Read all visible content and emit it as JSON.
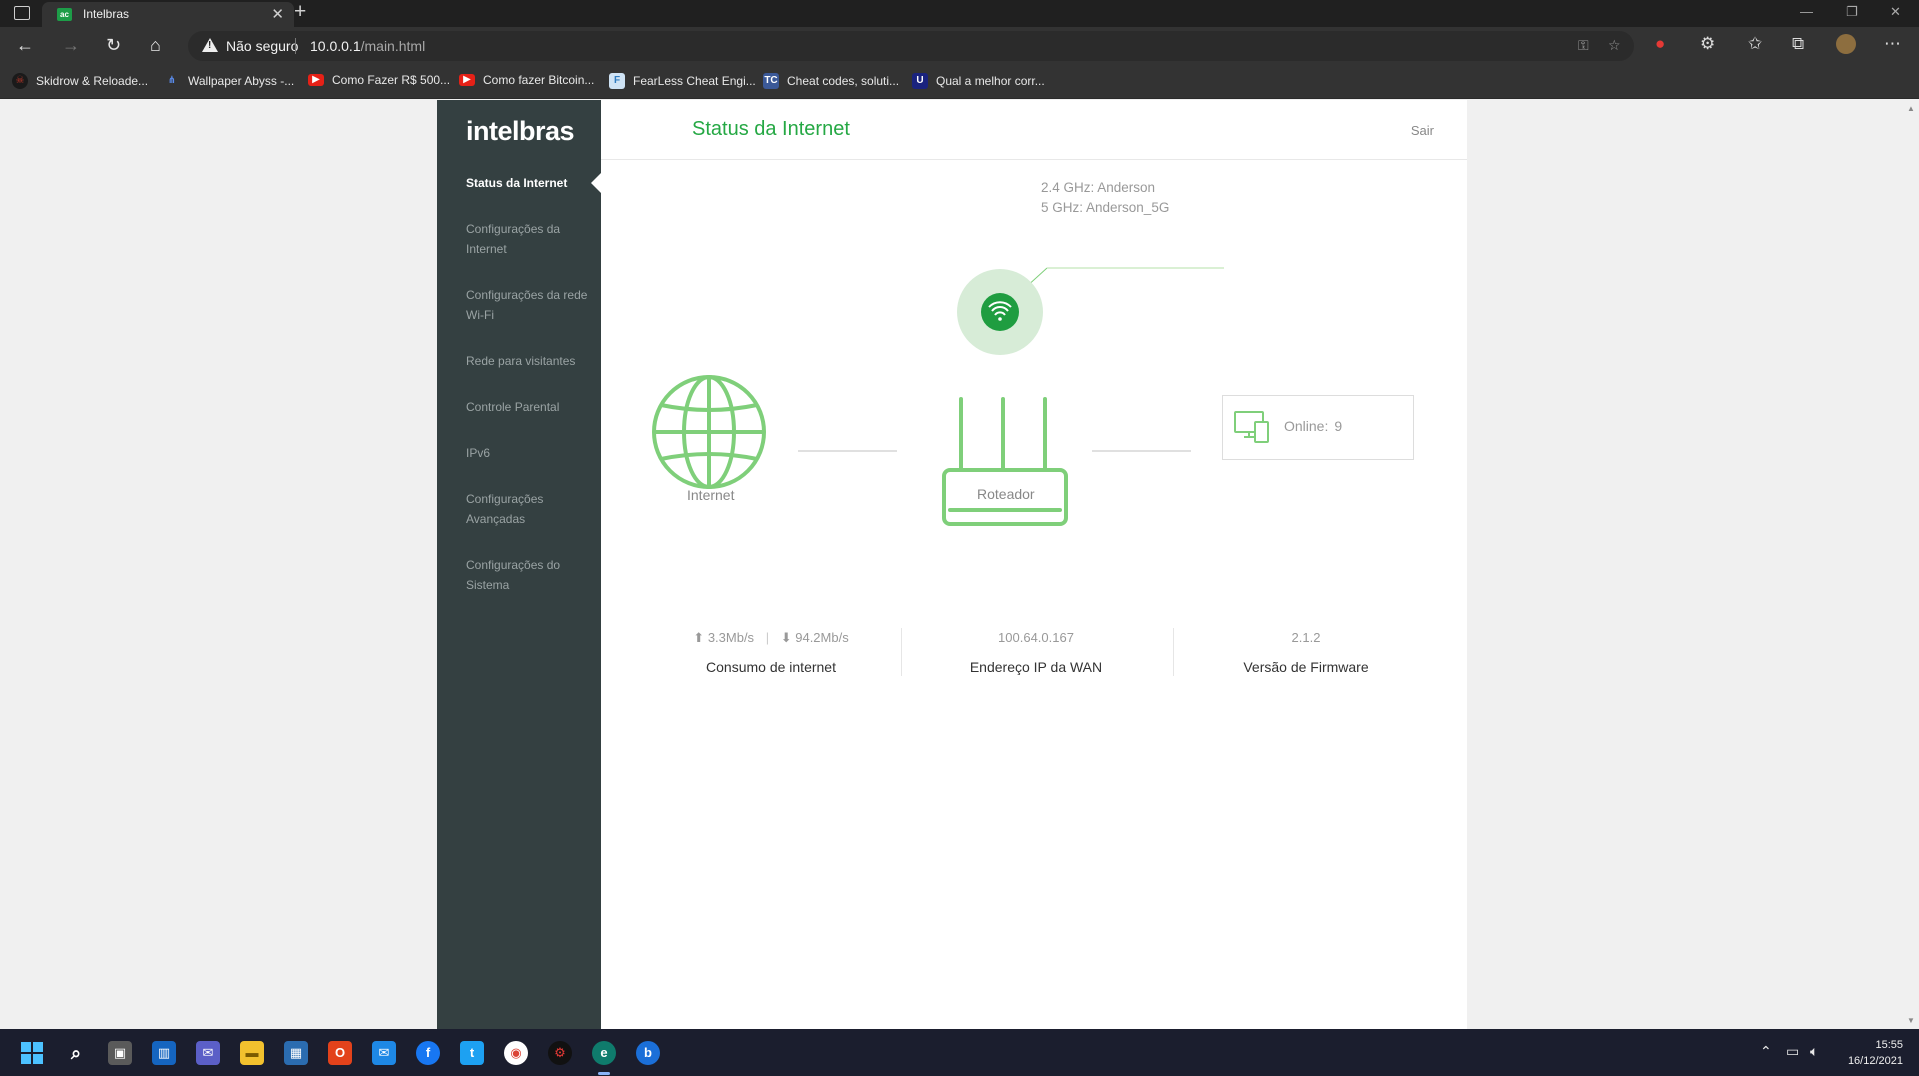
{
  "browser": {
    "tab_title": "Intelbras",
    "tab_favicon": "ac",
    "address_status": "Não seguro",
    "url_host": "10.0.0.1",
    "url_path": "/main.html",
    "bookmarks": [
      {
        "label": "Skidrow & Reloade...",
        "icon": "skull-icon",
        "color": "#c0392b"
      },
      {
        "label": "Wallpaper Abyss -...",
        "icon": "abyss-icon",
        "color": "#3a6fd8"
      },
      {
        "label": "Como Fazer R$ 500...",
        "icon": "youtube-icon",
        "color": "#e62117"
      },
      {
        "label": "Como fazer Bitcoin...",
        "icon": "youtube-icon",
        "color": "#e62117"
      },
      {
        "label": "FearLess Cheat Engi...",
        "icon": "fearless-icon",
        "color": "#2f7bbf"
      },
      {
        "label": "Cheat codes, soluti...",
        "icon": "tc-icon",
        "color": "#3b5998"
      },
      {
        "label": "Qual a melhor corr...",
        "icon": "u-icon",
        "color": "#1a237e"
      }
    ]
  },
  "router": {
    "logo": "intelbras",
    "page_title": "Status da Internet",
    "logout_label": "Sair",
    "sidebar": {
      "items": [
        {
          "label": "Status da Internet",
          "active": true
        },
        {
          "label": "Configurações da Internet",
          "active": false
        },
        {
          "label": "Configurações da rede Wi-Fi",
          "active": false
        },
        {
          "label": "Rede para visitantes",
          "active": false
        },
        {
          "label": "Controle Parental",
          "active": false
        },
        {
          "label": "IPv6",
          "active": false
        },
        {
          "label": "Configurações Avançadas",
          "active": false
        },
        {
          "label": "Configurações do Sistema",
          "active": false
        }
      ]
    },
    "wifi": {
      "ssid_24": "2.4 GHz: Anderson",
      "ssid_5": "5 GHz: Anderson_5G"
    },
    "diagram": {
      "internet_label": "Internet",
      "router_label": "Roteador",
      "online_label": "Online:",
      "online_count": "9"
    },
    "stats": {
      "upload": "3.3Mb/s",
      "download": "94.2Mb/s",
      "usage_label": "Consumo de internet",
      "wan_ip": "100.64.0.167",
      "wan_label": "Endereço IP da WAN",
      "firmware": "2.1.2",
      "firmware_label": "Versão de Firmware"
    },
    "colors": {
      "accent": "#25a844",
      "sidebar_bg": "#344041",
      "icon_green": "#7fcf7a"
    }
  },
  "taskbar": {
    "time": "15:55",
    "date": "16/12/2021"
  }
}
